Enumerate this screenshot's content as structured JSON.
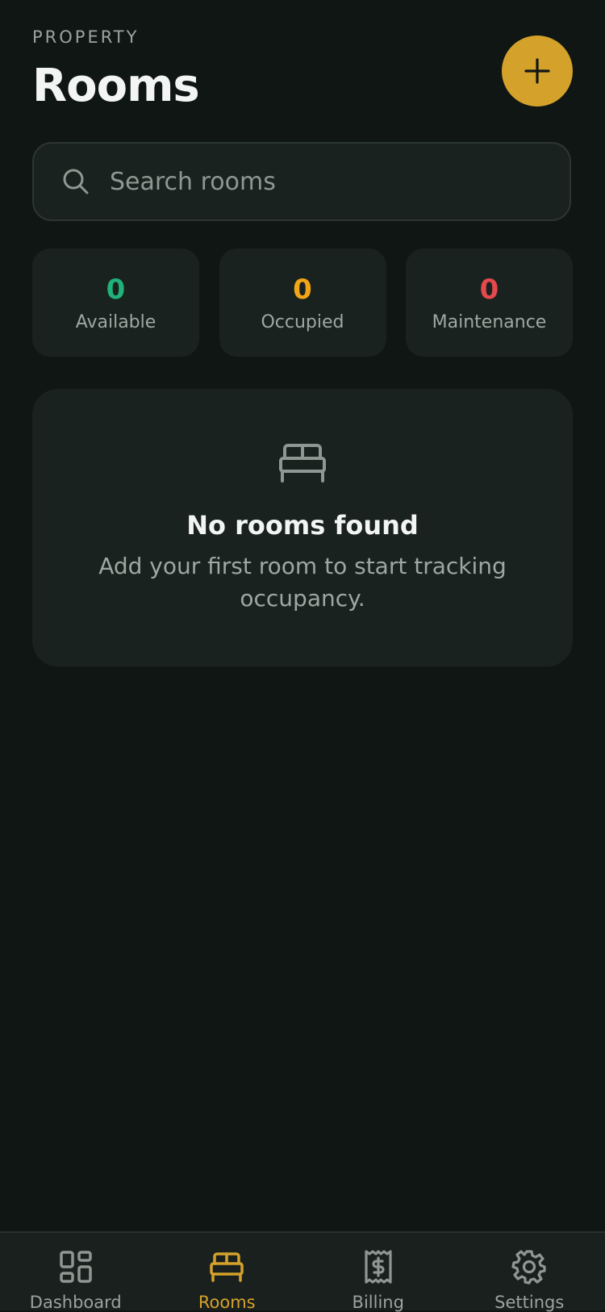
{
  "header": {
    "eyebrow": "PROPERTY",
    "title": "Rooms",
    "add_icon": "plus-icon"
  },
  "search": {
    "placeholder": "Search rooms",
    "value": "",
    "icon": "search-icon"
  },
  "stats": [
    {
      "value": "0",
      "label": "Available",
      "color": "#1fb27a"
    },
    {
      "value": "0",
      "label": "Occupied",
      "color": "#f2a516"
    },
    {
      "value": "0",
      "label": "Maintenance",
      "color": "#e5484d"
    }
  ],
  "empty_state": {
    "icon": "bed-icon",
    "title": "No rooms found",
    "description": "Add your first room to start tracking occupancy."
  },
  "tabs": [
    {
      "label": "Dashboard",
      "icon": "dashboard-icon",
      "active": false
    },
    {
      "label": "Rooms",
      "icon": "bed-icon",
      "active": true
    },
    {
      "label": "Billing",
      "icon": "receipt-icon",
      "active": false
    },
    {
      "label": "Settings",
      "icon": "gear-icon",
      "active": false
    }
  ],
  "colors": {
    "background": "#101614",
    "card": "#1a221f",
    "accent": "#d4a22a",
    "muted_text": "#9ea7a2"
  }
}
